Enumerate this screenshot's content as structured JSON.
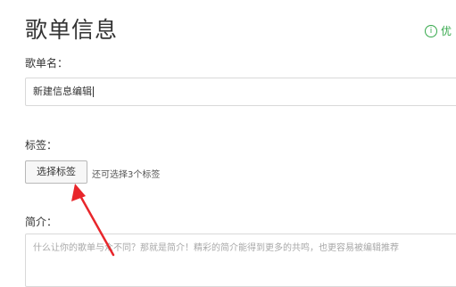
{
  "header": {
    "title": "歌单信息",
    "tip_text": "优",
    "tip_icon": "info-icon"
  },
  "form": {
    "name_label": "歌单名：",
    "name_value": "新建信息编辑",
    "tags_label": "标签：",
    "select_tags_button": "选择标签",
    "tags_hint": "还可选择3个标签",
    "intro_label": "简介：",
    "intro_placeholder": "什么让你的歌单与众不同？那就是简介！精彩的简介能得到更多的共鸣，也更容易被编辑推荐"
  },
  "colors": {
    "accent_green": "#35a84b",
    "annotation_arrow": "#e8262b"
  }
}
